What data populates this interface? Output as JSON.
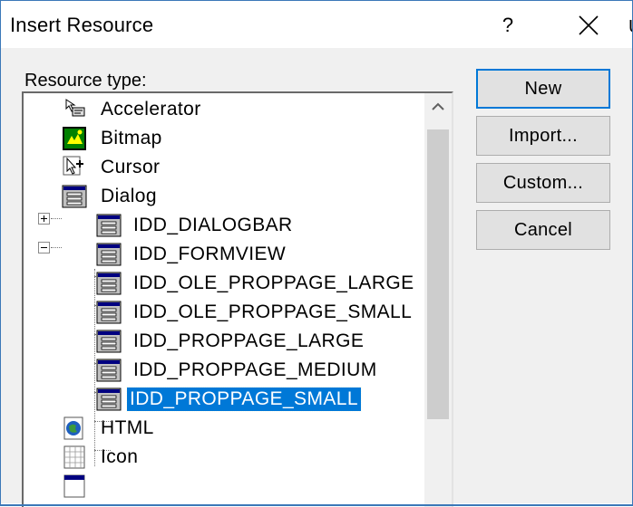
{
  "window": {
    "title": "Insert Resource",
    "help_label": "?",
    "edge_fragment": "U"
  },
  "resource_type_label": "Resource type:",
  "tree": {
    "top_items": [
      {
        "label": "Accelerator",
        "icon": "accelerator-icon"
      },
      {
        "label": "Bitmap",
        "icon": "bitmap-icon"
      },
      {
        "label": "Cursor",
        "icon": "cursor-icon",
        "expander": "collapsed"
      },
      {
        "label": "Dialog",
        "icon": "dialog-icon",
        "expander": "expanded"
      }
    ],
    "dialog_children": [
      "IDD_DIALOGBAR",
      "IDD_FORMVIEW",
      "IDD_OLE_PROPPAGE_LARGE",
      "IDD_OLE_PROPPAGE_SMALL",
      "IDD_PROPPAGE_LARGE",
      "IDD_PROPPAGE_MEDIUM",
      "IDD_PROPPAGE_SMALL"
    ],
    "selected": "IDD_PROPPAGE_SMALL",
    "after_items": [
      {
        "label": "HTML",
        "icon": "html-icon"
      },
      {
        "label": "Icon",
        "icon": "icon-resource-icon"
      }
    ]
  },
  "buttons": {
    "new": "New",
    "import": "Import...",
    "custom": "Custom...",
    "cancel": "Cancel"
  },
  "colors": {
    "selection": "#0078d7",
    "dialog_face": "#f0f0f0",
    "default_button_border": "#0078d7"
  }
}
